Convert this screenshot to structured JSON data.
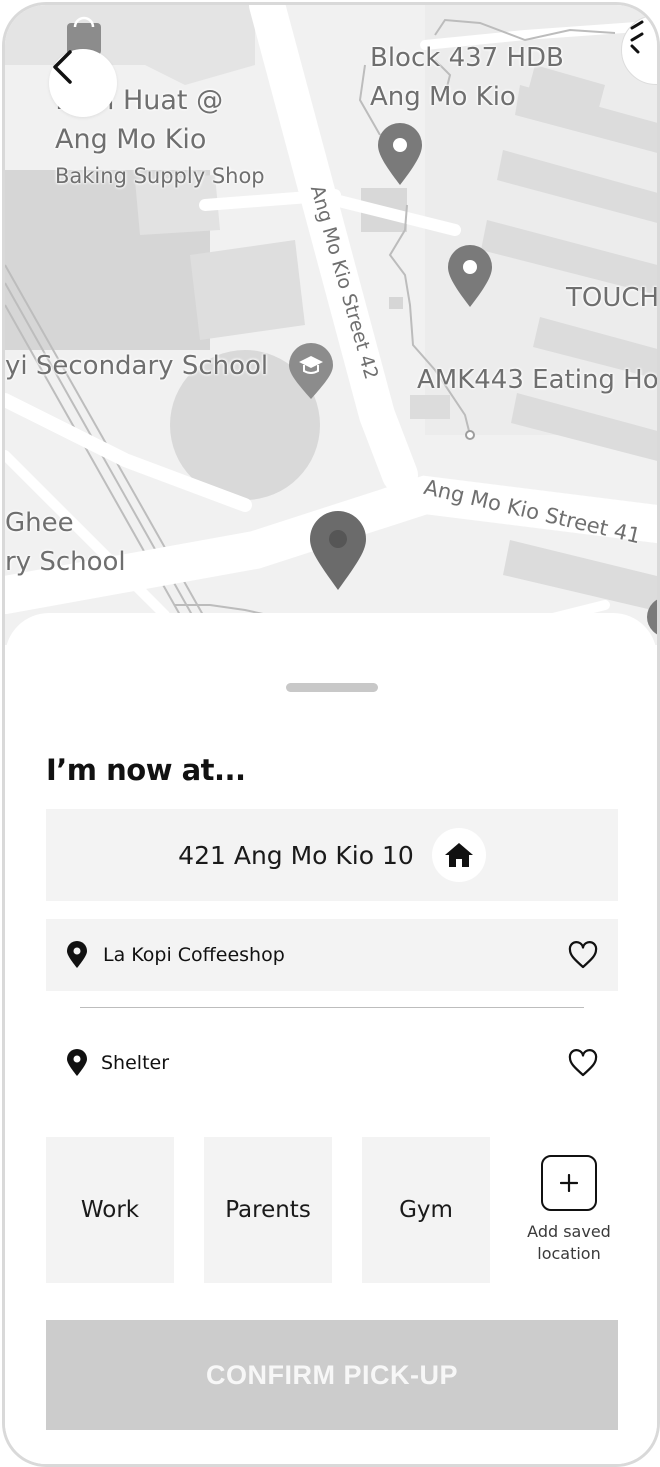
{
  "map": {
    "labels": {
      "shop_name_line1": "...on Huat @",
      "shop_name_line2": "Ang Mo Kio",
      "shop_category": "Baking Supply Shop",
      "block_line1": "Block 437 HDB",
      "block_line2": "Ang Mo Kio",
      "touch": "TOUCH",
      "school": "yi Secondary School",
      "eating_house": "AMK443 Eating Ho",
      "ghee_line1": "Ghee",
      "ghee_line2": "ry School",
      "street_42": "Ang Mo Kio Street 42",
      "street_41": "Ang Mo Kio Street 41"
    }
  },
  "sheet": {
    "title": "I’m now at...",
    "current_location": "421 Ang Mo Kio 10",
    "locations": [
      {
        "label": "La Kopi Coffeeshop"
      },
      {
        "label": "Shelter"
      }
    ],
    "saved": [
      {
        "label": "Work"
      },
      {
        "label": "Parents"
      },
      {
        "label": "Gym"
      }
    ],
    "add_saved_line1": "Add saved",
    "add_saved_line2": "location",
    "confirm_label": "CONFIRM PICK-UP"
  },
  "colors": {
    "map_background": "#f1f1f1",
    "tile_background": "#f3f3f3",
    "confirm_disabled": "#cccccc",
    "pin": "#7a7a7a"
  },
  "icons": [
    "back-arrow-icon",
    "home-icon",
    "location-pin-icon",
    "heart-icon",
    "plus-icon",
    "map-pin-icon",
    "shopping-bag-icon",
    "graduation-cap-icon"
  ]
}
